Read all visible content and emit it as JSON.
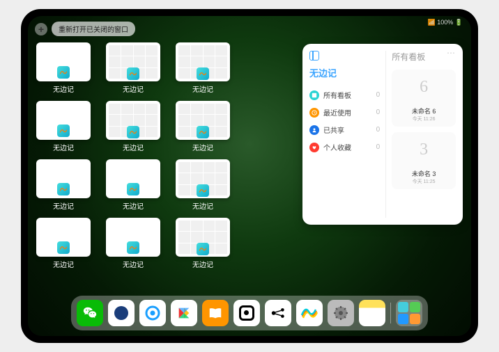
{
  "status": {
    "network": "📶 100% 🔋"
  },
  "topbar": {
    "reopen_label": "重新打开已关闭的窗口"
  },
  "app_name": "无边记",
  "windows_grid": {
    "rows": [
      {
        "items": [
          {
            "type": "blank"
          },
          {
            "type": "grid"
          },
          {
            "type": "grid"
          }
        ]
      },
      {
        "items": [
          {
            "type": "blank"
          },
          {
            "type": "grid"
          },
          {
            "type": "grid"
          }
        ]
      },
      {
        "items": [
          {
            "type": "blank"
          },
          {
            "type": "blank"
          },
          {
            "type": "grid"
          }
        ]
      },
      {
        "items": [
          {
            "type": "blank"
          },
          {
            "type": "blank"
          },
          {
            "type": "grid"
          }
        ]
      }
    ]
  },
  "panel": {
    "left_title": "无边记",
    "right_title": "所有看板",
    "items": [
      {
        "icon_color": "#2bd4d4",
        "label": "所有看板",
        "count": 0,
        "icon": "square"
      },
      {
        "icon_color": "#ff9500",
        "label": "最近使用",
        "count": 0,
        "icon": "clock"
      },
      {
        "icon_color": "#1a73e8",
        "label": "已共享",
        "count": 0,
        "icon": "person"
      },
      {
        "icon_color": "#ff3b30",
        "label": "个人收藏",
        "count": 0,
        "icon": "heart"
      }
    ],
    "boards": [
      {
        "sketch": "6",
        "name": "未命名 6",
        "meta": "今天 11:26"
      },
      {
        "sketch": "3",
        "name": "未命名 3",
        "meta": "今天 11:25"
      }
    ]
  },
  "dock": [
    {
      "name": "wechat",
      "bg": "#09bb07",
      "glyph": "wechat"
    },
    {
      "name": "app2",
      "bg": "#fff",
      "glyph": "circle-blue"
    },
    {
      "name": "browser",
      "bg": "#fff",
      "glyph": "q"
    },
    {
      "name": "play",
      "bg": "#fff",
      "glyph": "play"
    },
    {
      "name": "books",
      "bg": "#ff9500",
      "glyph": "book"
    },
    {
      "name": "dice",
      "bg": "#fff",
      "glyph": "dot"
    },
    {
      "name": "app7",
      "bg": "#fff",
      "glyph": "dots3"
    },
    {
      "name": "freeform",
      "bg": "#fff",
      "glyph": "squiggle"
    },
    {
      "name": "settings",
      "bg": "#bbb",
      "glyph": "gear"
    },
    {
      "name": "notes",
      "bg": "linear-gradient(#ffe15a 30%,#fff 30%)",
      "glyph": ""
    }
  ]
}
